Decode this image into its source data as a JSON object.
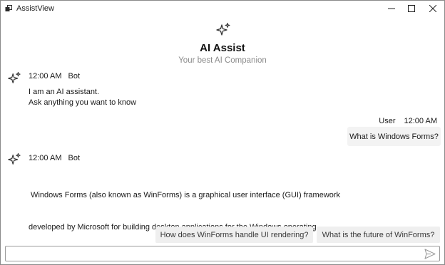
{
  "window": {
    "title": "AssistView",
    "controls": [
      "minimize-icon",
      "maximize-icon",
      "close-icon"
    ]
  },
  "header": {
    "icon": "sparkle-icon",
    "title": "AI Assist",
    "subtitle": "Your best AI Companion"
  },
  "messages": [
    {
      "role": "bot",
      "time": "12:00 AM",
      "sender": "Bot",
      "lines": [
        "I am an AI assistant.",
        "Ask anything you want to know"
      ]
    },
    {
      "role": "user",
      "time": "12:00 AM",
      "sender": "User",
      "lines": [
        "What is Windows Forms?"
      ]
    },
    {
      "role": "bot",
      "time": "12:00 AM",
      "sender": "Bot",
      "lines": [
        " Windows Forms (also known as WinForms) is a graphical user interface (GUI) framework",
        "developed by Microsoft for building desktop applications for the Windows operating"
      ]
    }
  ],
  "suggestions": [
    "How does WinForms handle UI rendering?",
    "What is the future of WinForms?"
  ],
  "input": {
    "value": "",
    "placeholder": "",
    "send_icon": "send-icon"
  },
  "colors": {
    "bubble": "#f3f3f3",
    "suggestion": "#efefef",
    "subtitle": "#8c8c8c",
    "border": "#9a9a9a"
  }
}
